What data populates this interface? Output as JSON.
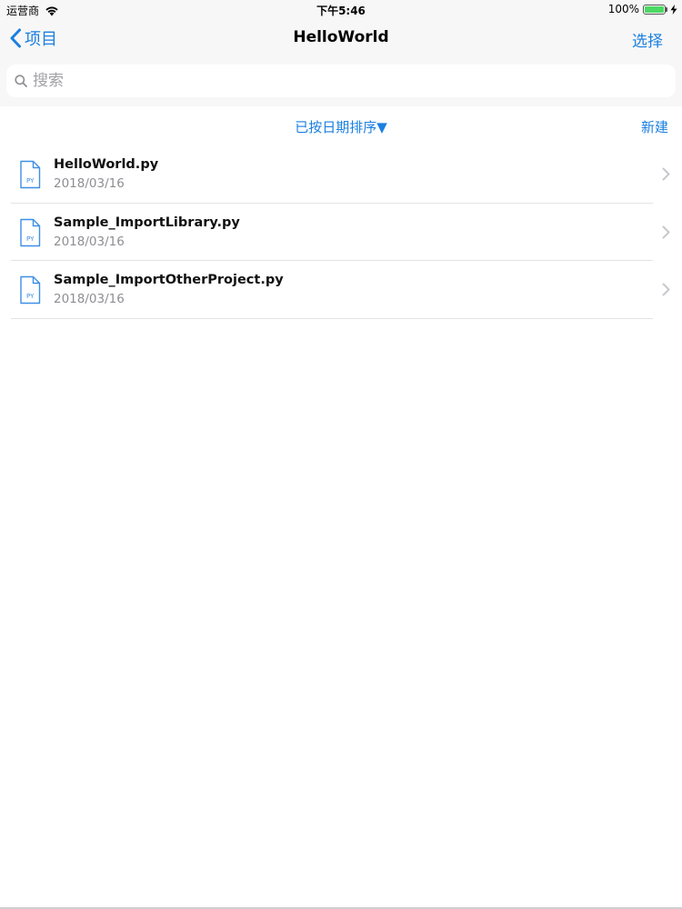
{
  "status_bar": {
    "carrier": "运营商",
    "time": "下午5:46",
    "battery_text": "100%",
    "battery_level": 1.0
  },
  "nav": {
    "back_label": "项目",
    "title": "HelloWorld",
    "select_label": "选择"
  },
  "search": {
    "placeholder": "搜索",
    "value": ""
  },
  "sort": {
    "label": "已按日期排序▼",
    "new_label": "新建"
  },
  "files": [
    {
      "name": "HelloWorld.py",
      "date": "2018/03/16",
      "icon_label": "PY"
    },
    {
      "name": "Sample_ImportLibrary.py",
      "date": "2018/03/16",
      "icon_label": "PY"
    },
    {
      "name": "Sample_ImportOtherProject.py",
      "date": "2018/03/16",
      "icon_label": "PY"
    }
  ],
  "icons": {
    "back": "chevron-left-icon",
    "search": "search-icon",
    "file": "python-file-icon",
    "disclosure": "chevron-right-icon",
    "wifi": "wifi-icon",
    "battery": "battery-icon",
    "charging": "bolt-icon"
  },
  "colors": {
    "accent": "#1a7fe0",
    "chrome_bg": "#f7f7f7",
    "secondary_text": "#8e8e93",
    "battery_fill": "#4cd964"
  }
}
